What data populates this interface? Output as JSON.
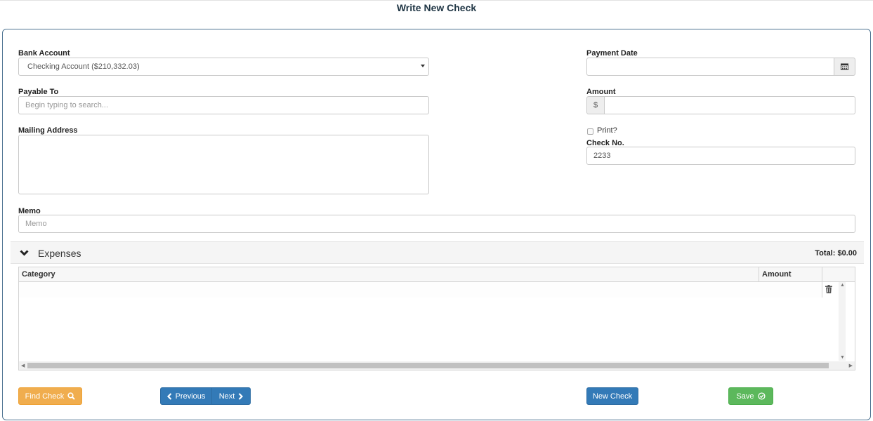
{
  "page": {
    "title": "Write New Check"
  },
  "form": {
    "bank_account": {
      "label": "Bank Account",
      "value": "Checking Account ($210,332.03)"
    },
    "payable_to": {
      "label": "Payable To",
      "placeholder": "Begin typing to search..."
    },
    "mailing_address": {
      "label": "Mailing Address",
      "value": ""
    },
    "memo": {
      "label": "Memo",
      "placeholder": "Memo"
    },
    "payment_date": {
      "label": "Payment Date",
      "value": ""
    },
    "amount": {
      "label": "Amount",
      "prefix": "$",
      "value": ""
    },
    "print": {
      "label": "Print?",
      "checked": false
    },
    "check_no": {
      "label": "Check No.",
      "value": "2233"
    }
  },
  "expenses": {
    "title": "Expenses",
    "total_label": "Total: $0.00",
    "columns": [
      "Category",
      "Amount"
    ],
    "rows": [
      {
        "category": "",
        "amount": ""
      }
    ]
  },
  "buttons": {
    "find_check": "Find Check",
    "previous": "Previous",
    "next": "Next",
    "new_check": "New Check",
    "save": "Save"
  },
  "colors": {
    "orange": "#f0ad4e",
    "blue": "#337ab7",
    "green": "#5cb85c",
    "panel_border": "#4d7391"
  }
}
